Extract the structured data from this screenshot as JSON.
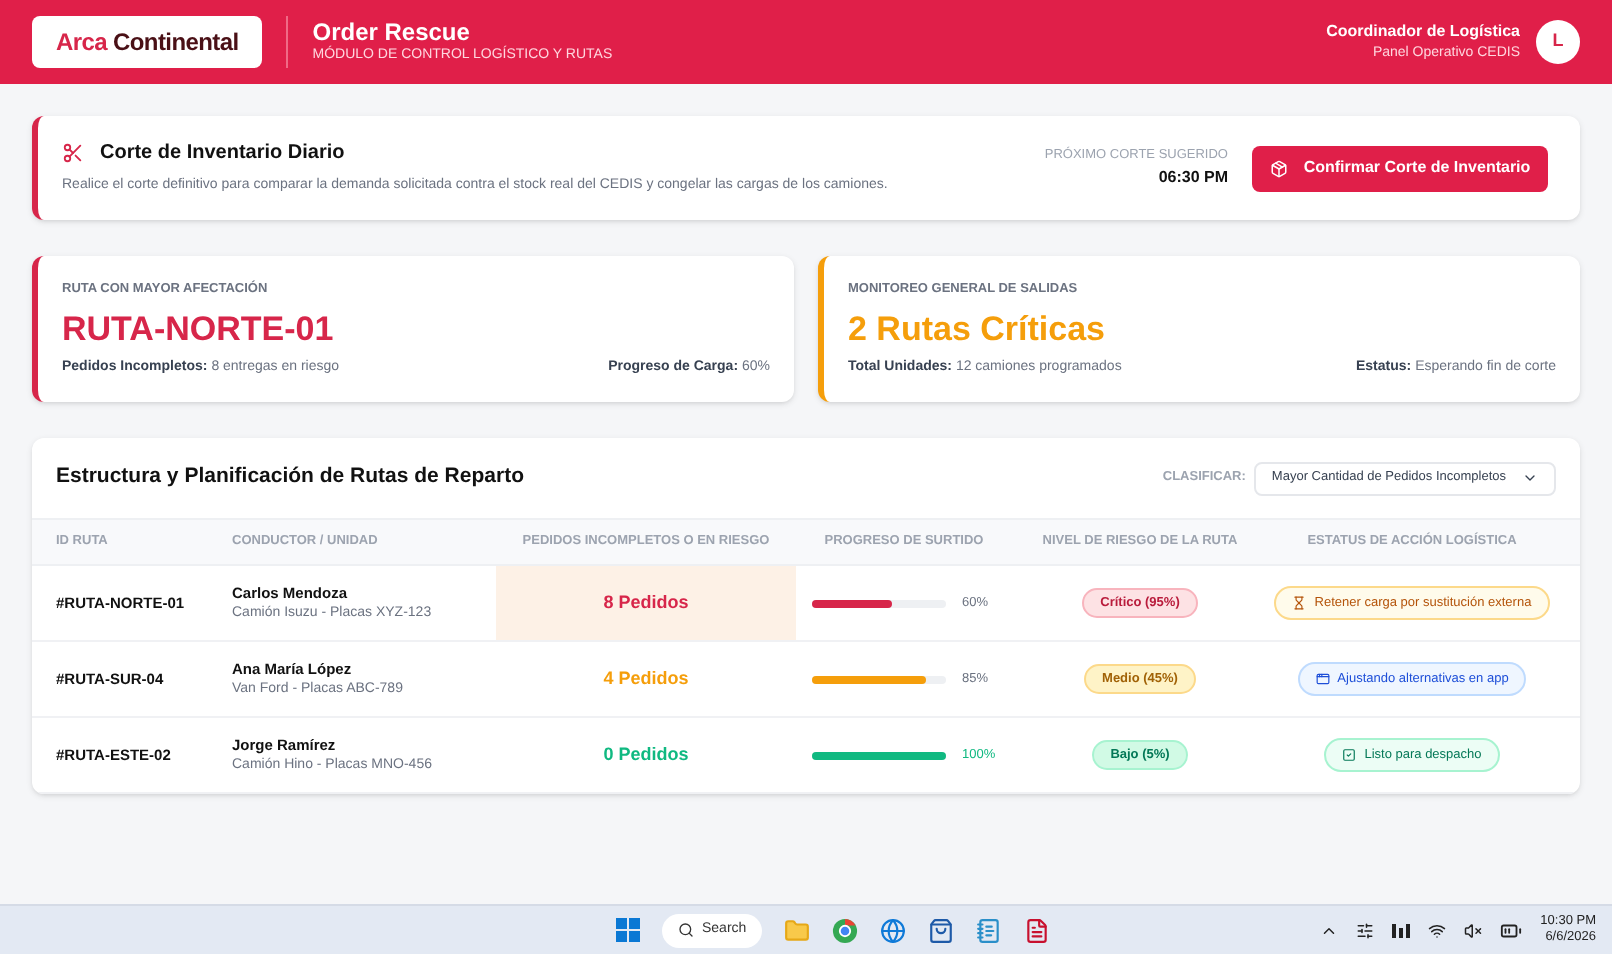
{
  "header": {
    "logo": {
      "part1": "Arca",
      "part2": "Continental"
    },
    "title": "Order Rescue",
    "subtitle": "MÓDULO DE CONTROL LOGÍSTICO Y RUTAS",
    "user": {
      "role": "Coordinador de Logística",
      "panel": "Panel Operativo CEDIS",
      "initial": "L"
    }
  },
  "cut": {
    "title": "Corte de Inventario Diario",
    "description": "Realice el corte definitivo para comparar la demanda solicitada contra el stock real del CEDIS y congelar las cargas de los camiones.",
    "next_label": "PRÓXIMO CORTE SUGERIDO",
    "next_time": "06:30 PM",
    "button": "Confirmar Corte de Inventario"
  },
  "metrics": [
    {
      "color": "#d7264a",
      "label": "RUTA CON MAYOR AFECTACIÓN",
      "value": "RUTA-NORTE-01",
      "left_key": "Pedidos Incompletos:",
      "left_value": "8 entregas en riesgo",
      "right_key": "Progreso de Carga:",
      "right_value": "60%"
    },
    {
      "color": "#f59e0b",
      "label": "MONITOREO GENERAL DE SALIDAS",
      "value": "2 Rutas Críticas",
      "left_key": "Total Unidades:",
      "left_value": "12 camiones programados",
      "right_key": "Estatus:",
      "right_value": "Esperando fin de corte"
    }
  ],
  "table": {
    "title": "Estructura y Planificación de Rutas de Reparto",
    "sort_label": "CLASIFICAR:",
    "sort_value": "Mayor Cantidad de Pedidos Incompletos",
    "columns": [
      "ID RUTA",
      "CONDUCTOR / UNIDAD",
      "PEDIDOS INCOMPLETOS O EN RIESGO",
      "PROGRESO DE SURTIDO",
      "NIVEL DE RIESGO DE LA RUTA",
      "ESTATUS DE ACCIÓN LOGÍSTICA"
    ],
    "rows": [
      {
        "kind": "hold",
        "id": "#RUTA-NORTE-01",
        "driver": "Carlos Mendoza",
        "unit": "Camión Isuzu - Placas XYZ-123",
        "orders": "8 Pedidos",
        "highlighted": true,
        "level": 0.6,
        "color": "#d7264a",
        "progress": "60%",
        "risk_label": "Crítico (95%)",
        "status": "Retener carga por sustitución externa"
      },
      {
        "kind": "app",
        "id": "#RUTA-SUR-04",
        "driver": "Ana María López",
        "unit": "Van Ford - Placas ABC-789",
        "orders": "4 Pedidos",
        "highlighted": false,
        "level": 0.85,
        "color": "#f59e0b",
        "progress": "85%",
        "risk_label": "Medio (45%)",
        "status": "Ajustando alternativas en app"
      },
      {
        "kind": "ready",
        "id": "#RUTA-ESTE-02",
        "driver": "Jorge Ramírez",
        "unit": "Camión Hino - Placas MNO-456",
        "orders": "0 Pedidos",
        "highlighted": false,
        "level": 1,
        "color": "#10b981",
        "progress": "100%",
        "risk_label": "Bajo (5%)",
        "status": "Listo para despacho"
      }
    ]
  },
  "taskbar": {
    "search": "Search",
    "time": "10:30 PM",
    "date": "6/6/2026"
  }
}
